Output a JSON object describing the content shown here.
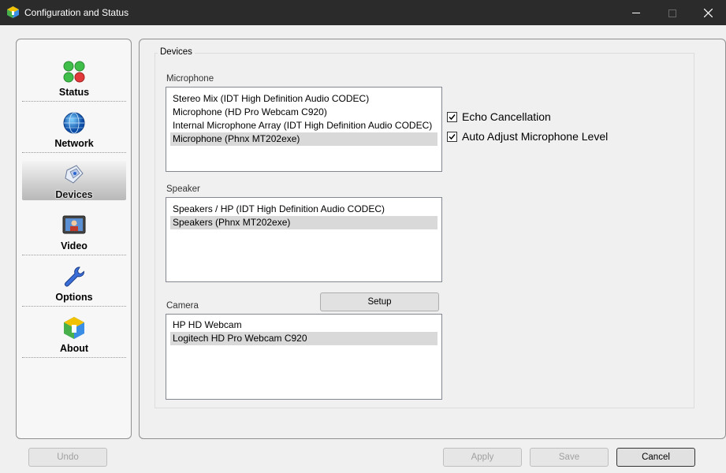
{
  "window": {
    "title": "Configuration and Status",
    "controls": [
      "minimize",
      "maximize",
      "close"
    ]
  },
  "sidebar": {
    "items": [
      {
        "label": "Status",
        "icon": "status-lights-icon",
        "selected": false
      },
      {
        "label": "Network",
        "icon": "globe-icon",
        "selected": false
      },
      {
        "label": "Devices",
        "icon": "usb-device-icon",
        "selected": true
      },
      {
        "label": "Video",
        "icon": "video-monitor-icon",
        "selected": false
      },
      {
        "label": "Options",
        "icon": "wrench-icon",
        "selected": false
      },
      {
        "label": "About",
        "icon": "about-logo-icon",
        "selected": false
      }
    ]
  },
  "devices": {
    "group_title": "Devices",
    "microphone": {
      "label": "Microphone",
      "items": [
        "Stereo Mix (IDT High Definition Audio CODEC)",
        "Microphone (HD Pro Webcam C920)",
        "Internal Microphone Array (IDT High Definition Audio CODEC)",
        "Microphone (Phnx MT202exe)"
      ],
      "selected_index": 3
    },
    "speaker": {
      "label": "Speaker",
      "items": [
        "Speakers / HP (IDT High Definition Audio CODEC)",
        "Speakers (Phnx MT202exe)"
      ],
      "selected_index": 1
    },
    "camera": {
      "label": "Camera",
      "setup_button": "Setup",
      "items": [
        "HP HD Webcam",
        "Logitech HD Pro Webcam C920"
      ],
      "selected_index": 1
    },
    "options": {
      "echo_cancellation": {
        "label": "Echo Cancellation",
        "checked": true
      },
      "auto_adjust": {
        "label": "Auto Adjust Microphone Level",
        "checked": true
      }
    }
  },
  "footer": {
    "undo": "Undo",
    "apply": "Apply",
    "save": "Save",
    "cancel": "Cancel"
  },
  "colors": {
    "titlebar": "#2b2b2b",
    "selection": "#d9d9d9",
    "panel_border": "#8f8f8f"
  }
}
